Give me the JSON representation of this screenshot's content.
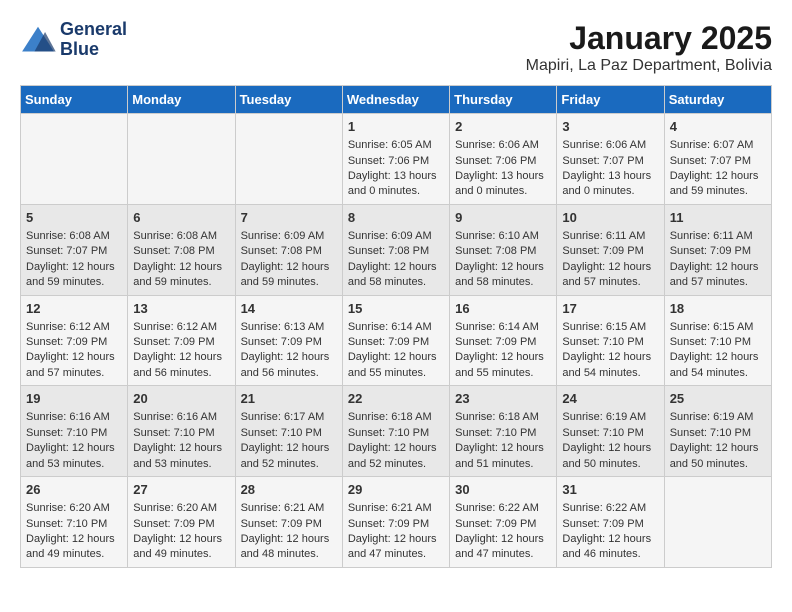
{
  "header": {
    "logo_line1": "General",
    "logo_line2": "Blue",
    "month_title": "January 2025",
    "location": "Mapiri, La Paz Department, Bolivia"
  },
  "days_of_week": [
    "Sunday",
    "Monday",
    "Tuesday",
    "Wednesday",
    "Thursday",
    "Friday",
    "Saturday"
  ],
  "weeks": [
    [
      {
        "day": "",
        "content": ""
      },
      {
        "day": "",
        "content": ""
      },
      {
        "day": "",
        "content": ""
      },
      {
        "day": "1",
        "content": "Sunrise: 6:05 AM\nSunset: 7:06 PM\nDaylight: 13 hours\nand 0 minutes."
      },
      {
        "day": "2",
        "content": "Sunrise: 6:06 AM\nSunset: 7:06 PM\nDaylight: 13 hours\nand 0 minutes."
      },
      {
        "day": "3",
        "content": "Sunrise: 6:06 AM\nSunset: 7:07 PM\nDaylight: 13 hours\nand 0 minutes."
      },
      {
        "day": "4",
        "content": "Sunrise: 6:07 AM\nSunset: 7:07 PM\nDaylight: 12 hours\nand 59 minutes."
      }
    ],
    [
      {
        "day": "5",
        "content": "Sunrise: 6:08 AM\nSunset: 7:07 PM\nDaylight: 12 hours\nand 59 minutes."
      },
      {
        "day": "6",
        "content": "Sunrise: 6:08 AM\nSunset: 7:08 PM\nDaylight: 12 hours\nand 59 minutes."
      },
      {
        "day": "7",
        "content": "Sunrise: 6:09 AM\nSunset: 7:08 PM\nDaylight: 12 hours\nand 59 minutes."
      },
      {
        "day": "8",
        "content": "Sunrise: 6:09 AM\nSunset: 7:08 PM\nDaylight: 12 hours\nand 58 minutes."
      },
      {
        "day": "9",
        "content": "Sunrise: 6:10 AM\nSunset: 7:08 PM\nDaylight: 12 hours\nand 58 minutes."
      },
      {
        "day": "10",
        "content": "Sunrise: 6:11 AM\nSunset: 7:09 PM\nDaylight: 12 hours\nand 57 minutes."
      },
      {
        "day": "11",
        "content": "Sunrise: 6:11 AM\nSunset: 7:09 PM\nDaylight: 12 hours\nand 57 minutes."
      }
    ],
    [
      {
        "day": "12",
        "content": "Sunrise: 6:12 AM\nSunset: 7:09 PM\nDaylight: 12 hours\nand 57 minutes."
      },
      {
        "day": "13",
        "content": "Sunrise: 6:12 AM\nSunset: 7:09 PM\nDaylight: 12 hours\nand 56 minutes."
      },
      {
        "day": "14",
        "content": "Sunrise: 6:13 AM\nSunset: 7:09 PM\nDaylight: 12 hours\nand 56 minutes."
      },
      {
        "day": "15",
        "content": "Sunrise: 6:14 AM\nSunset: 7:09 PM\nDaylight: 12 hours\nand 55 minutes."
      },
      {
        "day": "16",
        "content": "Sunrise: 6:14 AM\nSunset: 7:09 PM\nDaylight: 12 hours\nand 55 minutes."
      },
      {
        "day": "17",
        "content": "Sunrise: 6:15 AM\nSunset: 7:10 PM\nDaylight: 12 hours\nand 54 minutes."
      },
      {
        "day": "18",
        "content": "Sunrise: 6:15 AM\nSunset: 7:10 PM\nDaylight: 12 hours\nand 54 minutes."
      }
    ],
    [
      {
        "day": "19",
        "content": "Sunrise: 6:16 AM\nSunset: 7:10 PM\nDaylight: 12 hours\nand 53 minutes."
      },
      {
        "day": "20",
        "content": "Sunrise: 6:16 AM\nSunset: 7:10 PM\nDaylight: 12 hours\nand 53 minutes."
      },
      {
        "day": "21",
        "content": "Sunrise: 6:17 AM\nSunset: 7:10 PM\nDaylight: 12 hours\nand 52 minutes."
      },
      {
        "day": "22",
        "content": "Sunrise: 6:18 AM\nSunset: 7:10 PM\nDaylight: 12 hours\nand 52 minutes."
      },
      {
        "day": "23",
        "content": "Sunrise: 6:18 AM\nSunset: 7:10 PM\nDaylight: 12 hours\nand 51 minutes."
      },
      {
        "day": "24",
        "content": "Sunrise: 6:19 AM\nSunset: 7:10 PM\nDaylight: 12 hours\nand 50 minutes."
      },
      {
        "day": "25",
        "content": "Sunrise: 6:19 AM\nSunset: 7:10 PM\nDaylight: 12 hours\nand 50 minutes."
      }
    ],
    [
      {
        "day": "26",
        "content": "Sunrise: 6:20 AM\nSunset: 7:10 PM\nDaylight: 12 hours\nand 49 minutes."
      },
      {
        "day": "27",
        "content": "Sunrise: 6:20 AM\nSunset: 7:09 PM\nDaylight: 12 hours\nand 49 minutes."
      },
      {
        "day": "28",
        "content": "Sunrise: 6:21 AM\nSunset: 7:09 PM\nDaylight: 12 hours\nand 48 minutes."
      },
      {
        "day": "29",
        "content": "Sunrise: 6:21 AM\nSunset: 7:09 PM\nDaylight: 12 hours\nand 47 minutes."
      },
      {
        "day": "30",
        "content": "Sunrise: 6:22 AM\nSunset: 7:09 PM\nDaylight: 12 hours\nand 47 minutes."
      },
      {
        "day": "31",
        "content": "Sunrise: 6:22 AM\nSunset: 7:09 PM\nDaylight: 12 hours\nand 46 minutes."
      },
      {
        "day": "",
        "content": ""
      }
    ]
  ]
}
